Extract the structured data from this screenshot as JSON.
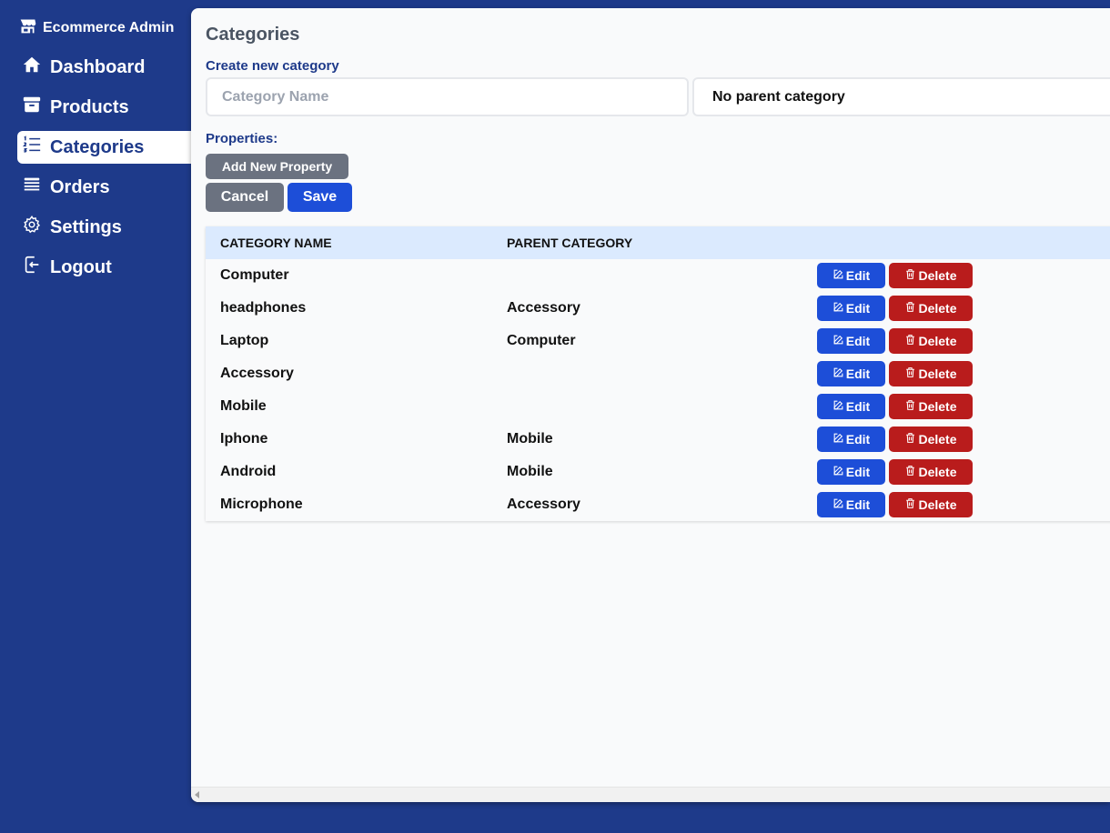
{
  "brand": {
    "title": "Ecommerce Admin",
    "icon": "store-icon"
  },
  "nav": [
    {
      "label": "Dashboard",
      "icon": "home-icon",
      "active": false
    },
    {
      "label": "Products",
      "icon": "archive-box-icon",
      "active": false
    },
    {
      "label": "Categories",
      "icon": "numbered-list-icon",
      "active": true
    },
    {
      "label": "Orders",
      "icon": "queue-list-icon",
      "active": false
    },
    {
      "label": "Settings",
      "icon": "gear-icon",
      "active": false
    },
    {
      "label": "Logout",
      "icon": "logout-icon",
      "active": false
    }
  ],
  "page": {
    "title": "Categories",
    "form_label": "Create new category",
    "name_placeholder": "Category Name",
    "name_value": "",
    "parent_selected": "No parent category",
    "properties_label": "Properties:",
    "add_property_label": "Add New Property",
    "cancel_label": "Cancel",
    "save_label": "Save"
  },
  "table": {
    "headers": [
      "CATEGORY NAME",
      "PARENT CATEGORY"
    ],
    "edit_label": "Edit",
    "delete_label": "Delete",
    "rows": [
      {
        "name": "Computer",
        "parent": ""
      },
      {
        "name": "headphones",
        "parent": "Accessory"
      },
      {
        "name": "Laptop",
        "parent": "Computer"
      },
      {
        "name": "Accessory",
        "parent": ""
      },
      {
        "name": "Mobile",
        "parent": ""
      },
      {
        "name": "Iphone",
        "parent": "Mobile"
      },
      {
        "name": "Android",
        "parent": "Mobile"
      },
      {
        "name": "Microphone",
        "parent": "Accessory"
      }
    ]
  },
  "colors": {
    "sidebar_bg": "#1e3a8a",
    "primary": "#1d4ed8",
    "danger": "#b91c1c",
    "neutral": "#6b7280",
    "table_header_bg": "#dbeafe"
  }
}
